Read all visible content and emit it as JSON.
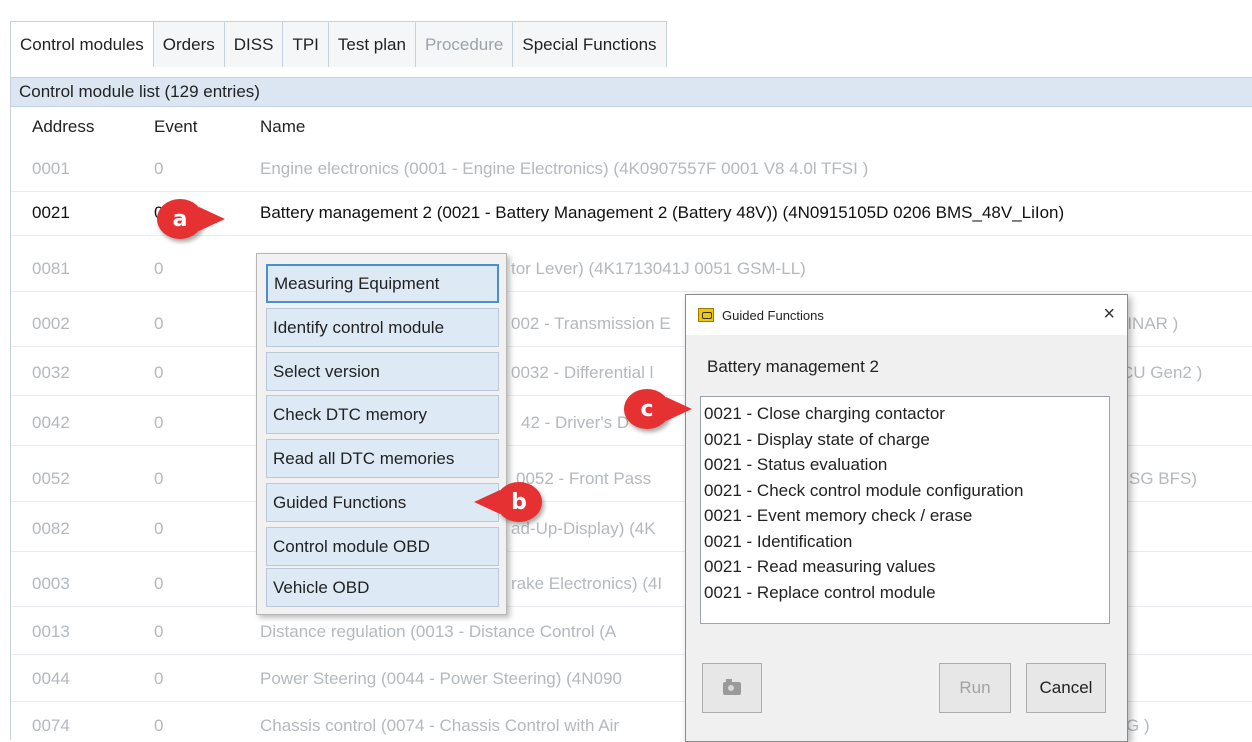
{
  "tabs": [
    {
      "label": "Control modules",
      "state": "active"
    },
    {
      "label": "Orders",
      "state": "normal"
    },
    {
      "label": "DISS",
      "state": "normal"
    },
    {
      "label": "TPI",
      "state": "normal"
    },
    {
      "label": "Test plan",
      "state": "normal"
    },
    {
      "label": "Procedure",
      "state": "disabled"
    },
    {
      "label": "Special Functions",
      "state": "normal"
    }
  ],
  "list": {
    "title": "Control module list (129 entries)",
    "columns": {
      "address": "Address",
      "event": "Event",
      "name": "Name"
    },
    "rows": [
      {
        "address": "0001",
        "event": "0",
        "name": "Engine electronics (0001 - Engine Electronics) (4K0907557F   0001   V8 4.0l TFSI )"
      },
      {
        "address": "0021",
        "event": "0",
        "name": "Battery management 2 (0021 - Battery Management 2 (Battery 48V)) (4N0915105D   0206   BMS_48V_LiIon)"
      },
      {
        "address": "0081",
        "event": "0",
        "name": "tor Lever) (4K1713041J   0051   GSM-LL)"
      },
      {
        "address": "0002",
        "event": "0",
        "name": "002 - Transmission E"
      },
      {
        "address": "0032",
        "event": "0",
        "name": "0032 - Differential l"
      },
      {
        "address": "0042",
        "event": "0",
        "name": "42 - Driver's D"
      },
      {
        "address": "0052",
        "event": "0",
        "name": "0052 - Front Pass"
      },
      {
        "address": "0082",
        "event": "0",
        "name": "ad-Up-Display) (4K"
      },
      {
        "address": "0003",
        "event": "0",
        "name": "rake Electronics) (4I"
      },
      {
        "address": "0013",
        "event": "0",
        "name": "Distance regulation (0013 - Distance Control (A"
      },
      {
        "address": "0044",
        "event": "0",
        "name": "Power Steering (0044 - Power Steering) (4N090"
      },
      {
        "address": "0074",
        "event": "0",
        "name": "Chassis control (0074 - Chassis Control with Air"
      }
    ],
    "right_fragments": [
      "SINAR )",
      "CU Gen2 )",
      "SG BFS)",
      "G )"
    ]
  },
  "context_menu": {
    "items": [
      "Measuring Equipment",
      "Identify control module",
      "Select version",
      "Check DTC memory",
      "Read all DTC memories",
      "Guided Functions",
      "Control module OBD",
      "Vehicle OBD"
    ]
  },
  "dialog": {
    "title": "Guided Functions",
    "close_glyph": "×",
    "subtitle": "Battery management 2",
    "items": [
      "0021  - Close charging contactor",
      "0021  - Display state of charge",
      "0021  - Status evaluation",
      "0021 - Check control module configuration",
      "0021 - Event memory check / erase",
      "0021 - Identification",
      "0021 - Read measuring values",
      "0021 - Replace control module"
    ],
    "run_label": "Run",
    "cancel_label": "Cancel",
    "camera_icon": "camera-icon"
  },
  "callouts": {
    "a": "a",
    "b": "b",
    "c": "c"
  },
  "colors": {
    "callout": "#e53131",
    "header_band": "#dbe6f2",
    "menu_item": "#dde9f5",
    "focus": "#4a8fd3"
  }
}
